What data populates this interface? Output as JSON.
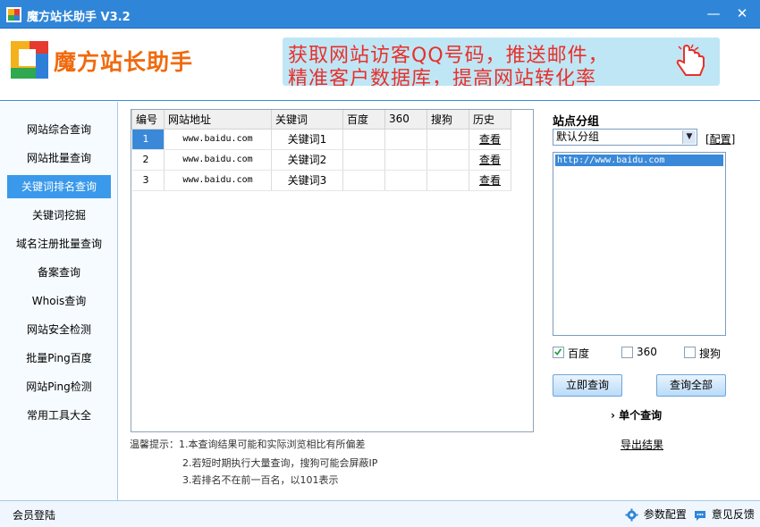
{
  "window": {
    "title": "魔方站长助手  V3.2",
    "minimize": "—",
    "close": "✕"
  },
  "header": {
    "brand": "魔方站长助手",
    "banner_line1": "获取网站访客QQ号码，推送邮件，",
    "banner_line2": "精准客户数据库，提高网站转化率"
  },
  "sidebar": {
    "items": [
      {
        "label": "网站综合查询"
      },
      {
        "label": "网站批量查询"
      },
      {
        "label": "关键词排名查询"
      },
      {
        "label": "关键词挖掘"
      },
      {
        "label": "域名注册批量查询"
      },
      {
        "label": "备案查询"
      },
      {
        "label": "Whois查询"
      },
      {
        "label": "网站安全检测"
      },
      {
        "label": "批量Ping百度"
      },
      {
        "label": "网站Ping检测"
      },
      {
        "label": "常用工具大全"
      }
    ],
    "active_index": 2
  },
  "grid": {
    "columns": [
      "编号",
      "网站地址",
      "关键词",
      "百度",
      "360",
      "搜狗",
      "历史"
    ],
    "rows": [
      {
        "num": "1",
        "url": "www.baidu.com",
        "keyword": "关键词1",
        "baidu": "",
        "s360": "",
        "sogou": "",
        "history": "查看"
      },
      {
        "num": "2",
        "url": "www.baidu.com",
        "keyword": "关键词2",
        "baidu": "",
        "s360": "",
        "sogou": "",
        "history": "查看"
      },
      {
        "num": "3",
        "url": "www.baidu.com",
        "keyword": "关键词3",
        "baidu": "",
        "s360": "",
        "sogou": "",
        "history": "查看"
      }
    ]
  },
  "tips": {
    "line1": "温馨提示：1.本查询结果可能和实际浏览相比有所偏差",
    "line2": "2.若短时期执行大量查询，搜狗可能会屏蔽IP",
    "line3": "3.若排名不在前一百名，以101表示"
  },
  "panel": {
    "title": "站点分组",
    "group_selected": "默认分组",
    "config_link": "[配置]",
    "sites": [
      "http://www.baidu.com"
    ],
    "engines": [
      {
        "label": "百度",
        "checked": true
      },
      {
        "label": "360",
        "checked": false
      },
      {
        "label": "搜狗",
        "checked": false
      }
    ],
    "query_now": "立即查询",
    "query_all": "查询全部",
    "single_query": "单个查询",
    "export": "导出结果"
  },
  "status": {
    "member": "会员登陆",
    "settings": "参数配置",
    "feedback": "意见反馈"
  },
  "colors": {
    "titlebar": "#2f86d8",
    "accent": "#3a99ea",
    "brand": "#f06a0e",
    "banner_bg": "#bfe6f5",
    "banner_text": "#e8302a"
  }
}
